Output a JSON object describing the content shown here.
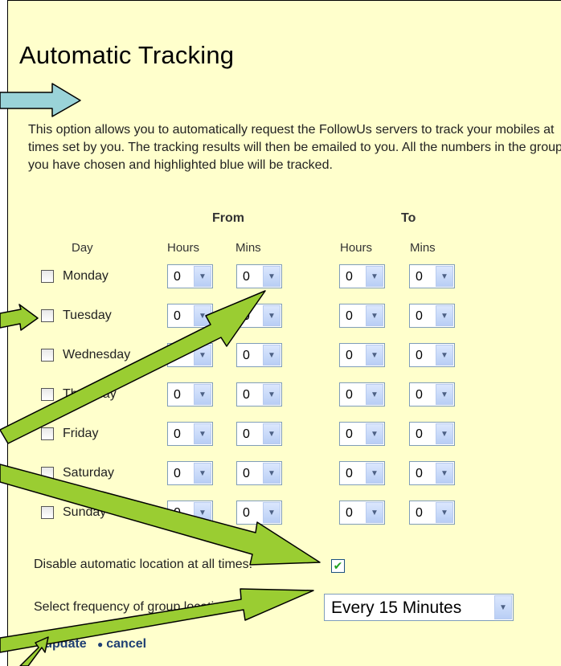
{
  "title": "Automatic Tracking",
  "description": "This option allows you to automatically request the FollowUs servers to track your mobiles at times set by you. The tracking results will then be emailed to you. All the numbers in the group you have chosen and highlighted blue will be tracked.",
  "headers": {
    "from": "From",
    "to": "To",
    "day": "Day",
    "from_hours": "Hours",
    "from_mins": "Mins",
    "to_hours": "Hours",
    "to_mins": "Mins"
  },
  "days": [
    {
      "label": "Monday",
      "from_hours": "0",
      "from_mins": "0",
      "to_hours": "0",
      "to_mins": "0"
    },
    {
      "label": "Tuesday",
      "from_hours": "0",
      "from_mins": "0",
      "to_hours": "0",
      "to_mins": "0"
    },
    {
      "label": "Wednesday",
      "from_hours": "0",
      "from_mins": "0",
      "to_hours": "0",
      "to_mins": "0"
    },
    {
      "label": "Thursday",
      "from_hours": "0",
      "from_mins": "0",
      "to_hours": "0",
      "to_mins": "0"
    },
    {
      "label": "Friday",
      "from_hours": "0",
      "from_mins": "0",
      "to_hours": "0",
      "to_mins": "0"
    },
    {
      "label": "Saturday",
      "from_hours": "0",
      "from_mins": "0",
      "to_hours": "0",
      "to_mins": "0"
    },
    {
      "label": "Sunday",
      "from_hours": "0",
      "from_mins": "0",
      "to_hours": "0",
      "to_mins": "0"
    }
  ],
  "disable": {
    "label": "Disable automatic location at all times:",
    "checked": true
  },
  "frequency": {
    "label": "Select frequency of group location",
    "value": "Every 15 Minutes"
  },
  "actions": {
    "update": "update",
    "cancel": "cancel"
  },
  "colors": {
    "panel_bg": "#ffffcc",
    "arrow_green": "#9acd32",
    "arrow_blue": "#9ad3d8",
    "link": "#1f3f73"
  }
}
